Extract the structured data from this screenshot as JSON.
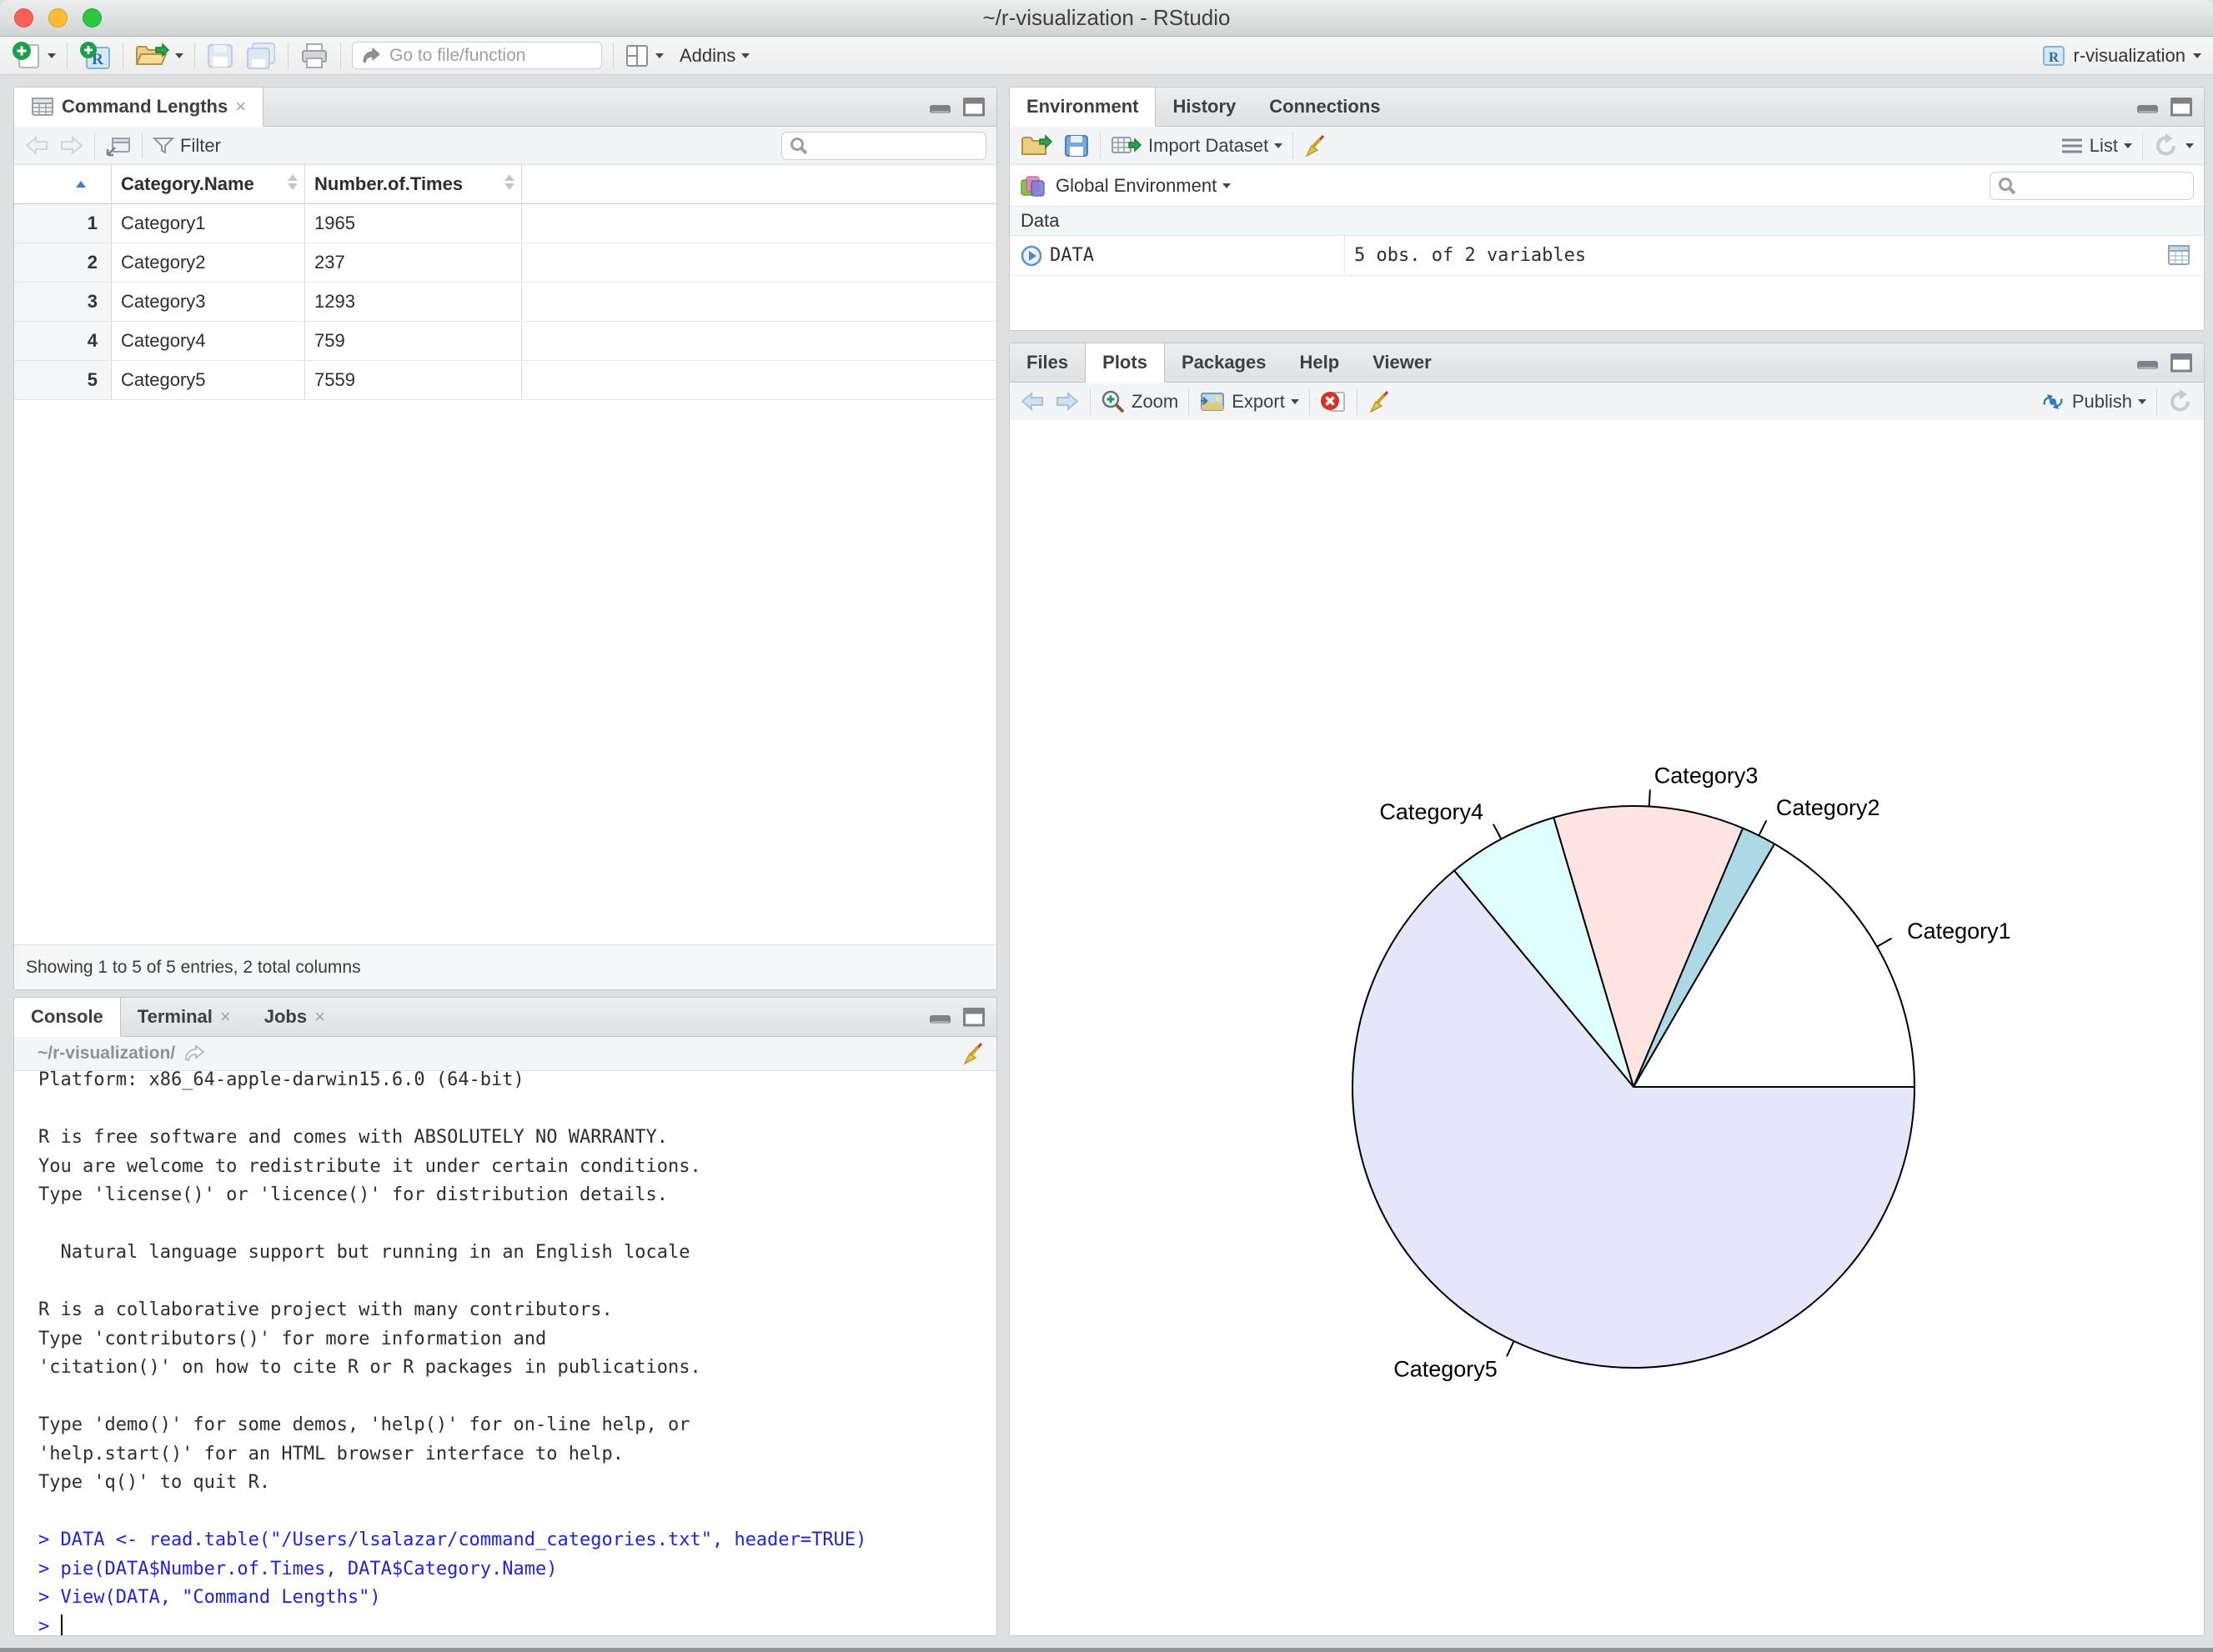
{
  "window": {
    "title": "~/r-visualization - RStudio",
    "project": "r-visualization"
  },
  "main_toolbar": {
    "goto_placeholder": "Go to file/function",
    "addins": "Addins"
  },
  "data_viewer": {
    "tab": "Command Lengths",
    "close": "×",
    "filter": "Filter",
    "columns": {
      "name": "Category.Name",
      "times": "Number.of.Times"
    },
    "rows": [
      [
        "1",
        "Category1",
        "1965"
      ],
      [
        "2",
        "Category2",
        "237"
      ],
      [
        "3",
        "Category3",
        "1293"
      ],
      [
        "4",
        "Category4",
        "759"
      ],
      [
        "5",
        "Category5",
        "7559"
      ]
    ],
    "footer": "Showing 1 to 5 of 5 entries, 2 total columns"
  },
  "environment": {
    "tabs": [
      "Environment",
      "History",
      "Connections"
    ],
    "import": "Import Dataset",
    "scope": "Global Environment",
    "list": "List",
    "section": "Data",
    "objects": [
      {
        "name": "DATA",
        "value": "5 obs. of 2 variables"
      }
    ]
  },
  "plots": {
    "tabs": [
      "Files",
      "Plots",
      "Packages",
      "Help",
      "Viewer"
    ],
    "zoom": "Zoom",
    "export": "Export",
    "publish": "Publish"
  },
  "console": {
    "tabs": [
      "Console",
      "Terminal",
      "Jobs"
    ],
    "close": "×",
    "path": "~/r-visualization/",
    "lines": [
      {
        "t": "Platform: x86_64-apple-darwin15.6.0 (64-bit)",
        "c": "out"
      },
      {
        "t": "",
        "c": "out"
      },
      {
        "t": "R is free software and comes with ABSOLUTELY NO WARRANTY.",
        "c": "out"
      },
      {
        "t": "You are welcome to redistribute it under certain conditions.",
        "c": "out"
      },
      {
        "t": "Type 'license()' or 'licence()' for distribution details.",
        "c": "out"
      },
      {
        "t": "",
        "c": "out"
      },
      {
        "t": "  Natural language support but running in an English locale",
        "c": "out"
      },
      {
        "t": "",
        "c": "out"
      },
      {
        "t": "R is a collaborative project with many contributors.",
        "c": "out"
      },
      {
        "t": "Type 'contributors()' for more information and",
        "c": "out"
      },
      {
        "t": "'citation()' on how to cite R or R packages in publications.",
        "c": "out"
      },
      {
        "t": "",
        "c": "out"
      },
      {
        "t": "Type 'demo()' for some demos, 'help()' for on-line help, or",
        "c": "out"
      },
      {
        "t": "'help.start()' for an HTML browser interface to help.",
        "c": "out"
      },
      {
        "t": "Type 'q()' to quit R.",
        "c": "out"
      },
      {
        "t": "",
        "c": "out"
      },
      {
        "t": "> DATA <- read.table(\"/Users/lsalazar/command_categories.txt\", header=TRUE)",
        "c": "in"
      },
      {
        "t": "> pie(DATA$Number.of.Times, DATA$Category.Name)",
        "c": "in"
      },
      {
        "t": "> View(DATA, \"Command Lengths\")",
        "c": "in"
      },
      {
        "t": "> ",
        "c": "in",
        "cursor": true
      }
    ]
  },
  "chart_data": {
    "type": "pie",
    "title": "",
    "categories": [
      "Category1",
      "Category2",
      "Category3",
      "Category4",
      "Category5"
    ],
    "values": [
      1965,
      237,
      1293,
      759,
      7559
    ],
    "colors": [
      "#FFFFFF",
      "#ADD8E6",
      "#FFE4E1",
      "#E0FFFF",
      "#E6E6FA"
    ],
    "start_angle_deg": 0,
    "direction": "counterclockwise",
    "legend": "none",
    "stroke_color": "#000000"
  }
}
